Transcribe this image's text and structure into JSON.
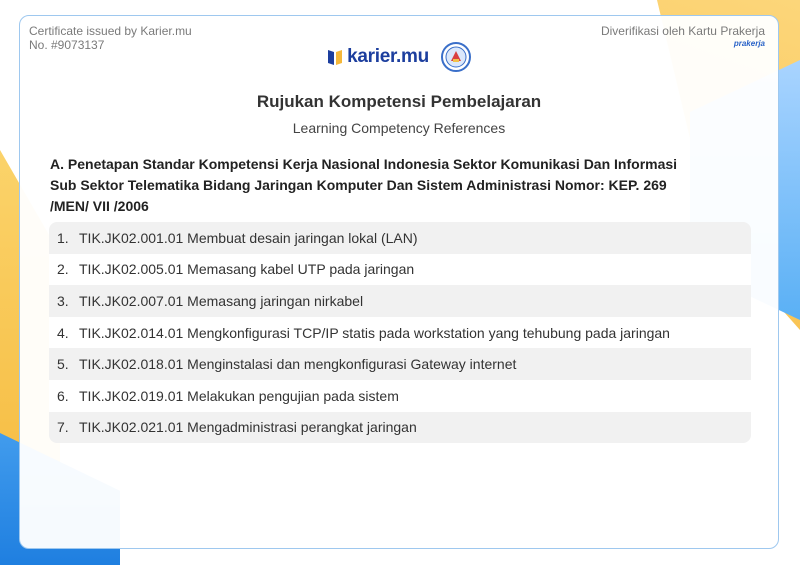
{
  "header": {
    "issued_by": "Certificate issued by Karier.mu",
    "certificate_no": "No. #9073137",
    "verified_by": "Diverifikasi oleh Kartu Prakerja",
    "prakerja_logo_text": "prakerja"
  },
  "logos": {
    "brand_name": "karier.mu",
    "brand_color": "#1c3e9e"
  },
  "title": "Rujukan Kompetensi Pembelajaran",
  "subtitle": "Learning Competency References",
  "section": {
    "title": "A. Penetapan Standar Kompetensi Kerja Nasional Indonesia Sektor Komunikasi Dan Informasi Sub Sektor Telematika Bidang Jaringan Komputer Dan Sistem Administrasi Nomor: KEP. 269 /MEN/ VII /2006",
    "items": [
      {
        "num": "1.",
        "text": "TIK.JK02.001.01 Membuat desain jaringan lokal (LAN)"
      },
      {
        "num": "2.",
        "text": "TIK.JK02.005.01 Memasang kabel UTP pada jaringan"
      },
      {
        "num": "3.",
        "text": "TIK.JK02.007.01 Memasang jaringan nirkabel"
      },
      {
        "num": "4.",
        "text": "TIK.JK02.014.01 Mengkonfigurasi TCP/IP statis pada workstation yang tehubung pada jaringan"
      },
      {
        "num": "5.",
        "text": "TIK.JK02.018.01 Menginstalasi dan mengkonfigurasi Gateway internet"
      },
      {
        "num": "6.",
        "text": "TIK.JK02.019.01 Melakukan pengujian pada sistem"
      },
      {
        "num": "7.",
        "text": "TIK.JK02.021.01 Mengadministrasi perangkat jaringan"
      }
    ]
  }
}
